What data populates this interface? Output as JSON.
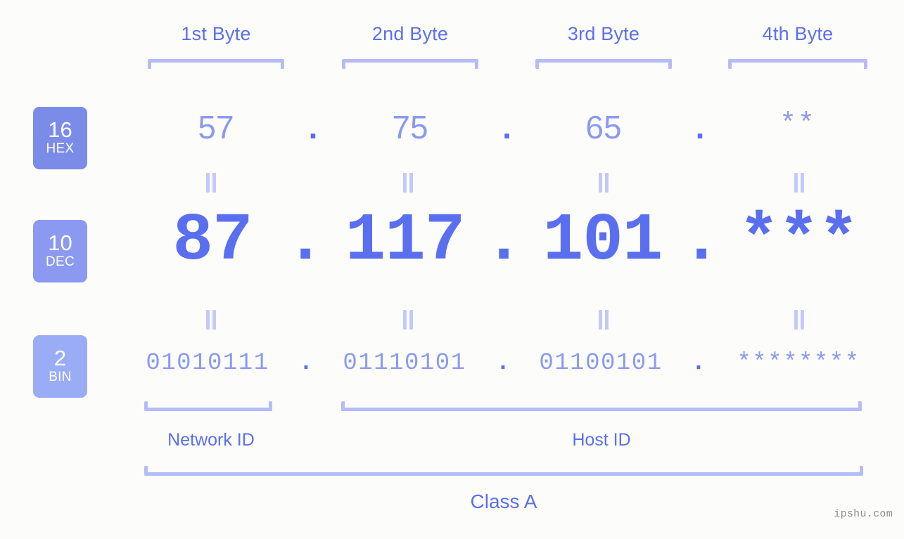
{
  "meta": {
    "background_color": "#fcfdfa",
    "accent_color": "#5a6ff0",
    "light_accent_color": "#8b9af0",
    "bracket_color": "#b4bcf9"
  },
  "headers": [
    {
      "label": "1st Byte"
    },
    {
      "label": "2nd Byte"
    },
    {
      "label": "3rd Byte"
    },
    {
      "label": "4th Byte"
    }
  ],
  "bases": [
    {
      "number": "16",
      "name": "HEX",
      "color": "#7b8ce8"
    },
    {
      "number": "10",
      "name": "DEC",
      "color": "#8b9af0"
    },
    {
      "number": "2",
      "name": "BIN",
      "color": "#9aacf5"
    }
  ],
  "rows": {
    "hex": {
      "values": [
        "57",
        "75",
        "65",
        "**"
      ],
      "separator": "."
    },
    "dec": {
      "values": [
        "87",
        "117",
        "101",
        "***"
      ],
      "separator": "."
    },
    "bin": {
      "values": [
        "01010111",
        "01110101",
        "01100101",
        "********"
      ],
      "separator": "."
    }
  },
  "sections": {
    "network_id": "Network ID",
    "host_id": "Host ID",
    "class": "Class A"
  },
  "watermark": "ipshu.com"
}
